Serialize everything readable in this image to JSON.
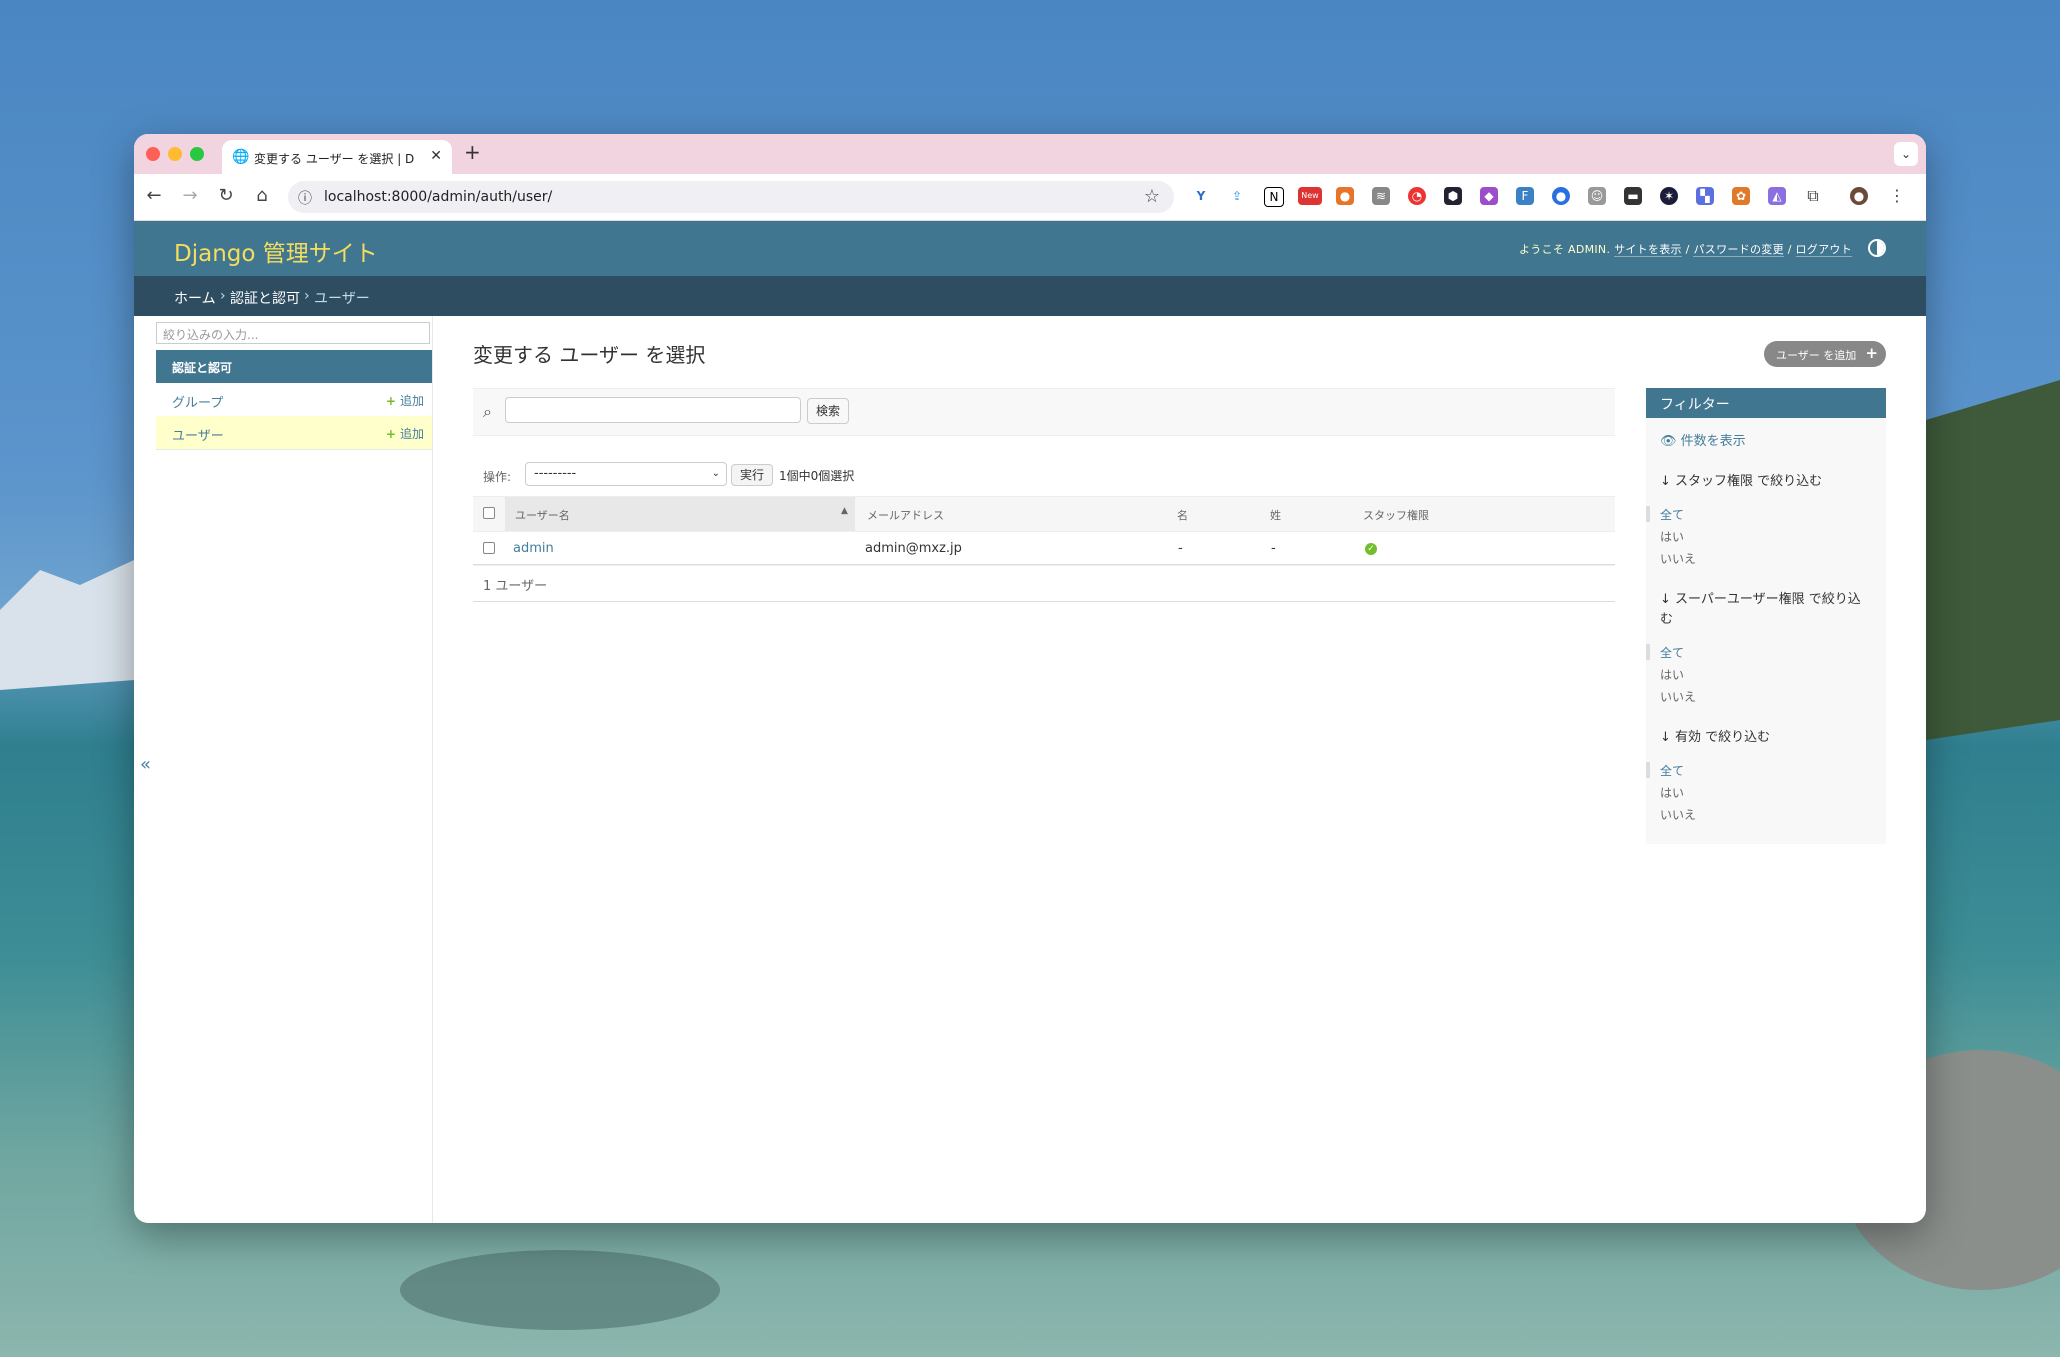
{
  "browser": {
    "tab_title": "変更する ユーザー を選択 | Django",
    "url": "localhost:8000/admin/auth/user/",
    "extension_badge_new": "New"
  },
  "header": {
    "branding": "Django 管理サイト",
    "welcome": "ようこそ ADMIN.",
    "view_site": "サイトを表示",
    "change_password": "パスワードの変更",
    "logout": "ログアウト",
    "separator": "/"
  },
  "breadcrumbs": {
    "home": "ホーム",
    "app": "認証と認可",
    "current": "ユーザー",
    "sep": "›"
  },
  "sidebar": {
    "filter_placeholder": "絞り込みの入力...",
    "app_caption": "認証と認可",
    "models": [
      {
        "name": "グループ",
        "add": "追加"
      },
      {
        "name": "ユーザー",
        "add": "追加"
      }
    ],
    "collapse": "«"
  },
  "content": {
    "title": "変更する ユーザー を選択",
    "add_button": "ユーザー を追加",
    "search_button": "検索",
    "action_label": "操作:",
    "action_value": "---------",
    "run_button": "実行",
    "selection_counter": "1個中0個選択",
    "columns": [
      "ユーザー名",
      "メールアドレス",
      "名",
      "姓",
      "スタッフ権限"
    ],
    "rows": [
      {
        "username": "admin",
        "email": "admin@mxz.jp",
        "first_name": "-",
        "last_name": "-"
      }
    ],
    "paginator": "1 ユーザー"
  },
  "filter": {
    "title": "フィルター",
    "show_counts": "件数を表示",
    "groups": [
      {
        "title": "スタッフ権限 で絞り込む",
        "options": [
          "全て",
          "はい",
          "いいえ"
        ]
      },
      {
        "title": "スーパーユーザー権限 で絞り込む",
        "options": [
          "全て",
          "はい",
          "いいえ"
        ]
      },
      {
        "title": "有効 で絞り込む",
        "options": [
          "全て",
          "はい",
          "いいえ"
        ]
      }
    ]
  },
  "colors": {
    "primary": "#417690",
    "breadcrumbs": "#2f4d61",
    "branding": "#f5dd5d",
    "link": "#447e9b",
    "selected_row": "#ffffcc",
    "ok": "#70bf2b"
  }
}
